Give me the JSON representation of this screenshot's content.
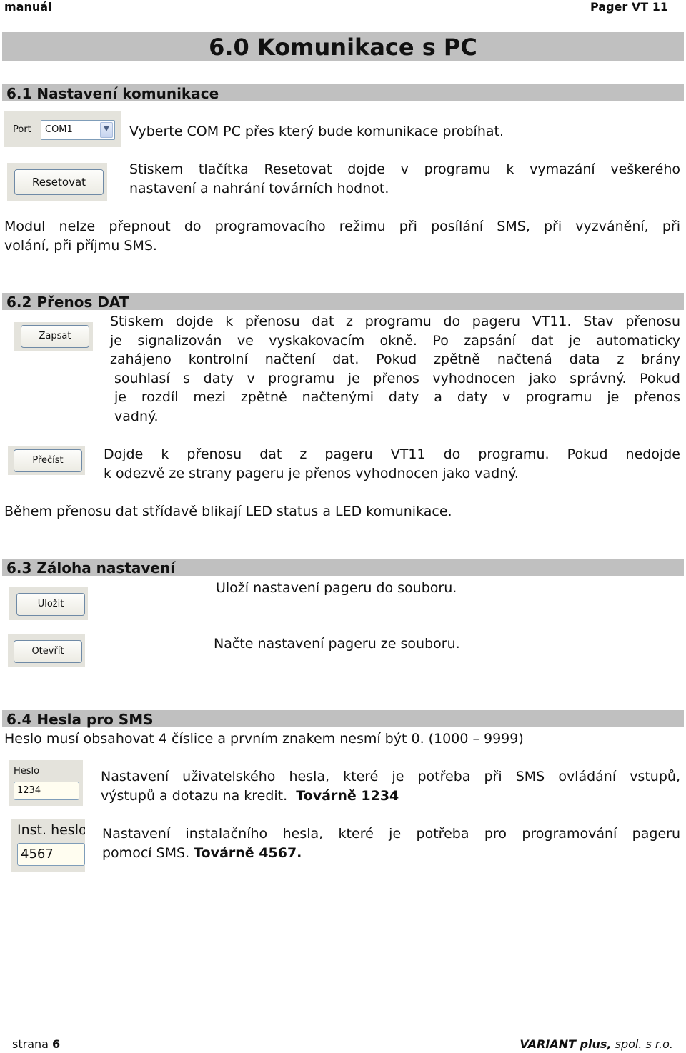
{
  "header": {
    "left": "manuál",
    "right": "Pager VT 11"
  },
  "chapter_title": "6.0 Komunikace s PC",
  "sections": {
    "s61": {
      "title": "6.1 Nastavení komunikace",
      "port_label": "Port",
      "port_value": "COM1",
      "port_text": "Vyberte COM PC přes který bude komunikace probíhat.",
      "reset_button": "Resetovat",
      "reset_text_1": "Stiskem tlačítka Resetovat dojde v programu k vymazání veškerého",
      "reset_text_2": "nastavení a nahrání továrních hodnot.",
      "note_1": "Modul nelze přepnout do programovacího režimu při posílání SMS, při vyzvánění, při",
      "note_2": "volání, při příjmu SMS."
    },
    "s62": {
      "title": "6.2 Přenos DAT",
      "write_button": "Zapsat",
      "write_lines": [
        "Stiskem dojde k přenosu dat z programu do pageru VT11. Stav přenosu",
        "je signalizován ve vyskakovacím okně. Po zapsání dat je automaticky",
        "zahájeno kontrolní načtení dat. Pokud zpětně načtená data z brány",
        "souhlasí s daty v programu je přenos vyhodnocen jako správný. Pokud",
        "je rozdíl mezi zpětně načtenými daty a daty v programu je přenos",
        "vadný."
      ],
      "read_button": "Přečíst",
      "read_lines": [
        "Dojde k přenosu dat z pageru VT11 do programu. Pokud nedojde",
        "k odezvě ze strany pageru je přenos vyhodnocen jako vadný."
      ],
      "led_note": "Během přenosu dat střídavě blikají LED status a LED komunikace."
    },
    "s63": {
      "title": "6.3 Záloha nastavení",
      "save_button": "Uložit",
      "save_text": "Uloží nastavení pageru do souboru.",
      "open_button": "Otevřít",
      "open_text": "Načte nastavení pageru ze souboru."
    },
    "s64": {
      "title": "6.4 Hesla pro SMS",
      "intro": "Heslo musí obsahovat 4 číslice a prvním znakem nesmí být 0.  (1000 – 9999)",
      "user_label": "Heslo",
      "user_value": "1234",
      "user_text_1": "Nastavení uživatelského hesla, které je potřeba při SMS ovládání vstupů,",
      "user_text_2": "výstupů a dotazu na kredit.",
      "user_default": "Továrně 1234",
      "inst_label": "Inst. heslo",
      "inst_value": "4567",
      "inst_text_1": "Nastavení instalačního hesla, které je potřeba pro programování pageru",
      "inst_text_2": "pomocí SMS.",
      "inst_default": "Továrně 4567."
    }
  },
  "footer": {
    "page_label": "strana",
    "page_number": "6",
    "company_bold": "VARIANT plus,",
    "company_rest": " spol. s r.o."
  }
}
